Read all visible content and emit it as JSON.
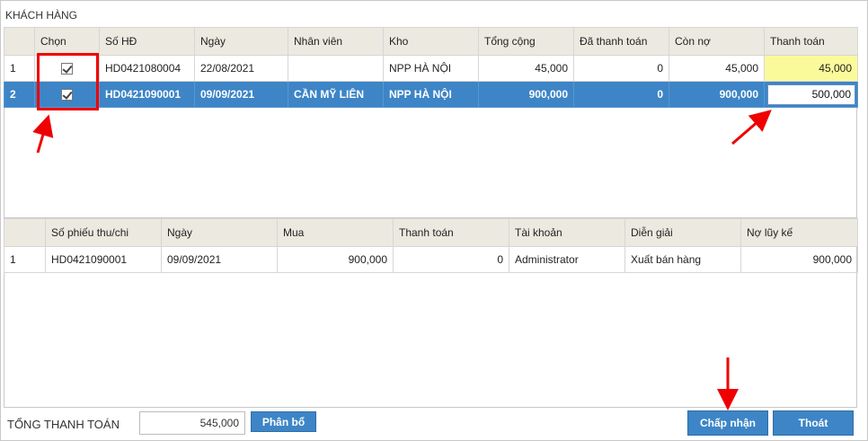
{
  "section_title": "KHÁCH HÀNG",
  "invoices": {
    "headers": [
      "",
      "Chọn",
      "Số HĐ",
      "Ngày",
      "Nhân viên",
      "Kho",
      "Tổng cộng",
      "Đã thanh toán",
      "Còn nợ",
      "Thanh toán"
    ],
    "rows": [
      {
        "idx": "1",
        "checked": true,
        "so_hd": "HD0421080004",
        "ngay": "22/08/2021",
        "nhan_vien": "",
        "kho": "NPP HÀ NỘI",
        "tong_cong": "45,000",
        "da_tt": "0",
        "con_no": "45,000",
        "thanh_toan": "45,000"
      },
      {
        "idx": "2",
        "checked": true,
        "so_hd": "HD0421090001",
        "ngay": "09/09/2021",
        "nhan_vien": "CẦN MỸ LIÊN",
        "kho": "NPP HÀ NỘI",
        "tong_cong": "900,000",
        "da_tt": "0",
        "con_no": "900,000",
        "thanh_toan": "500,000"
      }
    ]
  },
  "receipts": {
    "headers": [
      "",
      "Số phiếu thu/chi",
      "Ngày",
      "Mua",
      "Thanh toán",
      "Tài khoản",
      "Diễn giải",
      "Nợ lũy kế"
    ],
    "rows": [
      {
        "idx": "1",
        "so_phieu": "HD0421090001",
        "ngay": "09/09/2021",
        "mua": "900,000",
        "thanh_toan": "0",
        "tai_khoan": "Administrator",
        "dien_giai": "Xuất bán hàng",
        "no_luy_ke": "900,000"
      }
    ]
  },
  "footer": {
    "total_label": "TỔNG THANH TOÁN",
    "total_value": "545,000",
    "allocate_label": "Phân bổ",
    "accept_label": "Chấp nhận",
    "exit_label": "Thoát"
  },
  "colors": {
    "accent": "#3d85c6",
    "highlight_yellow": "#fbfa9a",
    "annotation_red": "#e00000"
  }
}
